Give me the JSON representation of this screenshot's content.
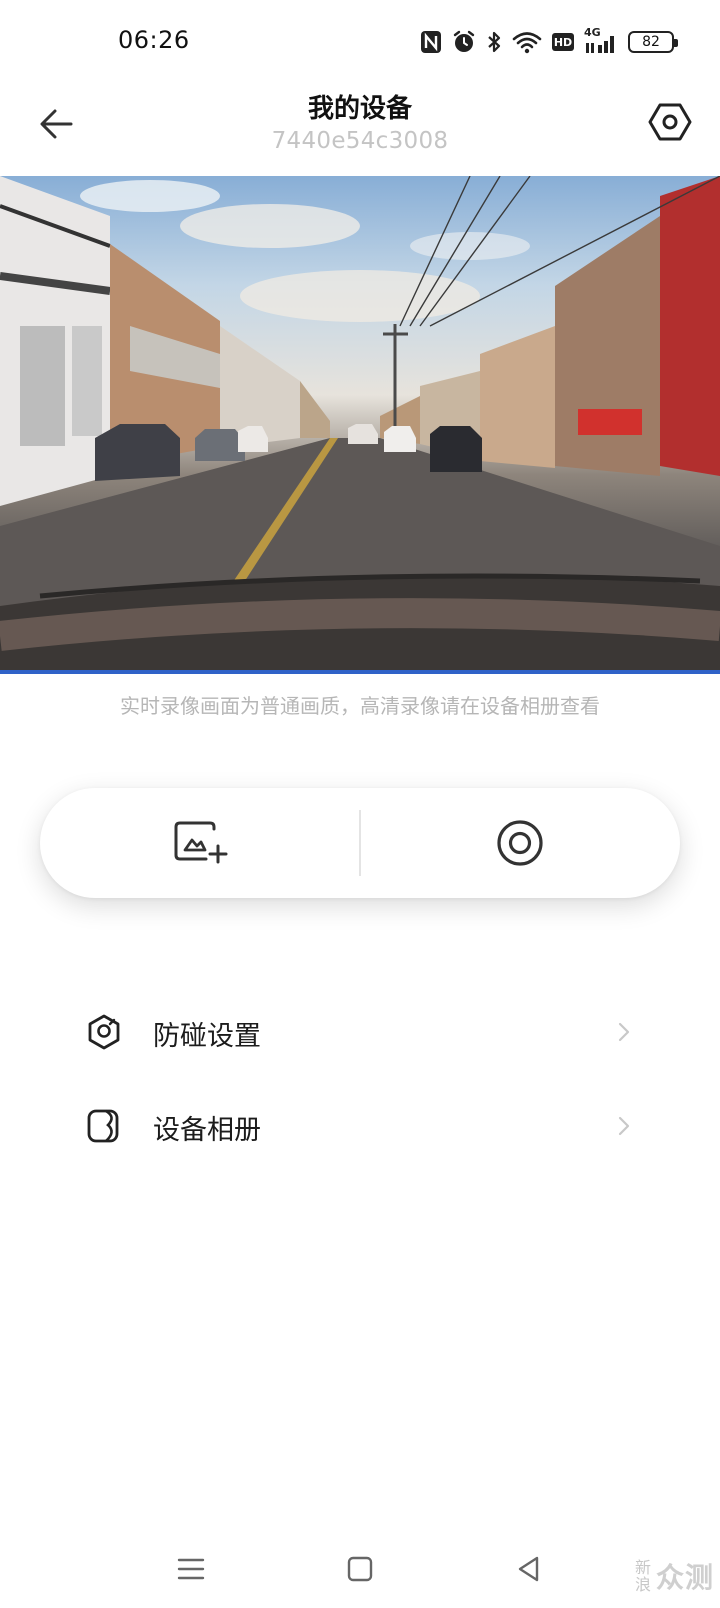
{
  "status_bar": {
    "time": "06:26",
    "network": "4G",
    "hd_label": "HD",
    "battery": "82",
    "icons": [
      "nfc-icon",
      "alarm-icon",
      "bluetooth-icon",
      "wifi-icon",
      "hd-icon",
      "signal-4g-icon",
      "battery-icon"
    ]
  },
  "header": {
    "title": "我的设备",
    "subtitle": "7440e54c3008",
    "back_icon": "arrow-left-icon",
    "settings_icon": "hexagon-settings-icon"
  },
  "video": {
    "note": "实时录像画面为普通画质，高清录像请在设备相册查看",
    "progress_color": "#2f62c8"
  },
  "controls": {
    "photo_icon": "capture-photo-icon",
    "record_icon": "record-icon"
  },
  "menu": [
    {
      "label": "防碰设置",
      "icon": "collision-shield-icon"
    },
    {
      "label": "设备相册",
      "icon": "album-icon"
    }
  ],
  "nav_bar": {
    "icons": [
      "menu-lines-icon",
      "home-square-icon",
      "back-triangle-icon"
    ]
  },
  "watermark": {
    "small": "新浪",
    "big": "众测"
  }
}
